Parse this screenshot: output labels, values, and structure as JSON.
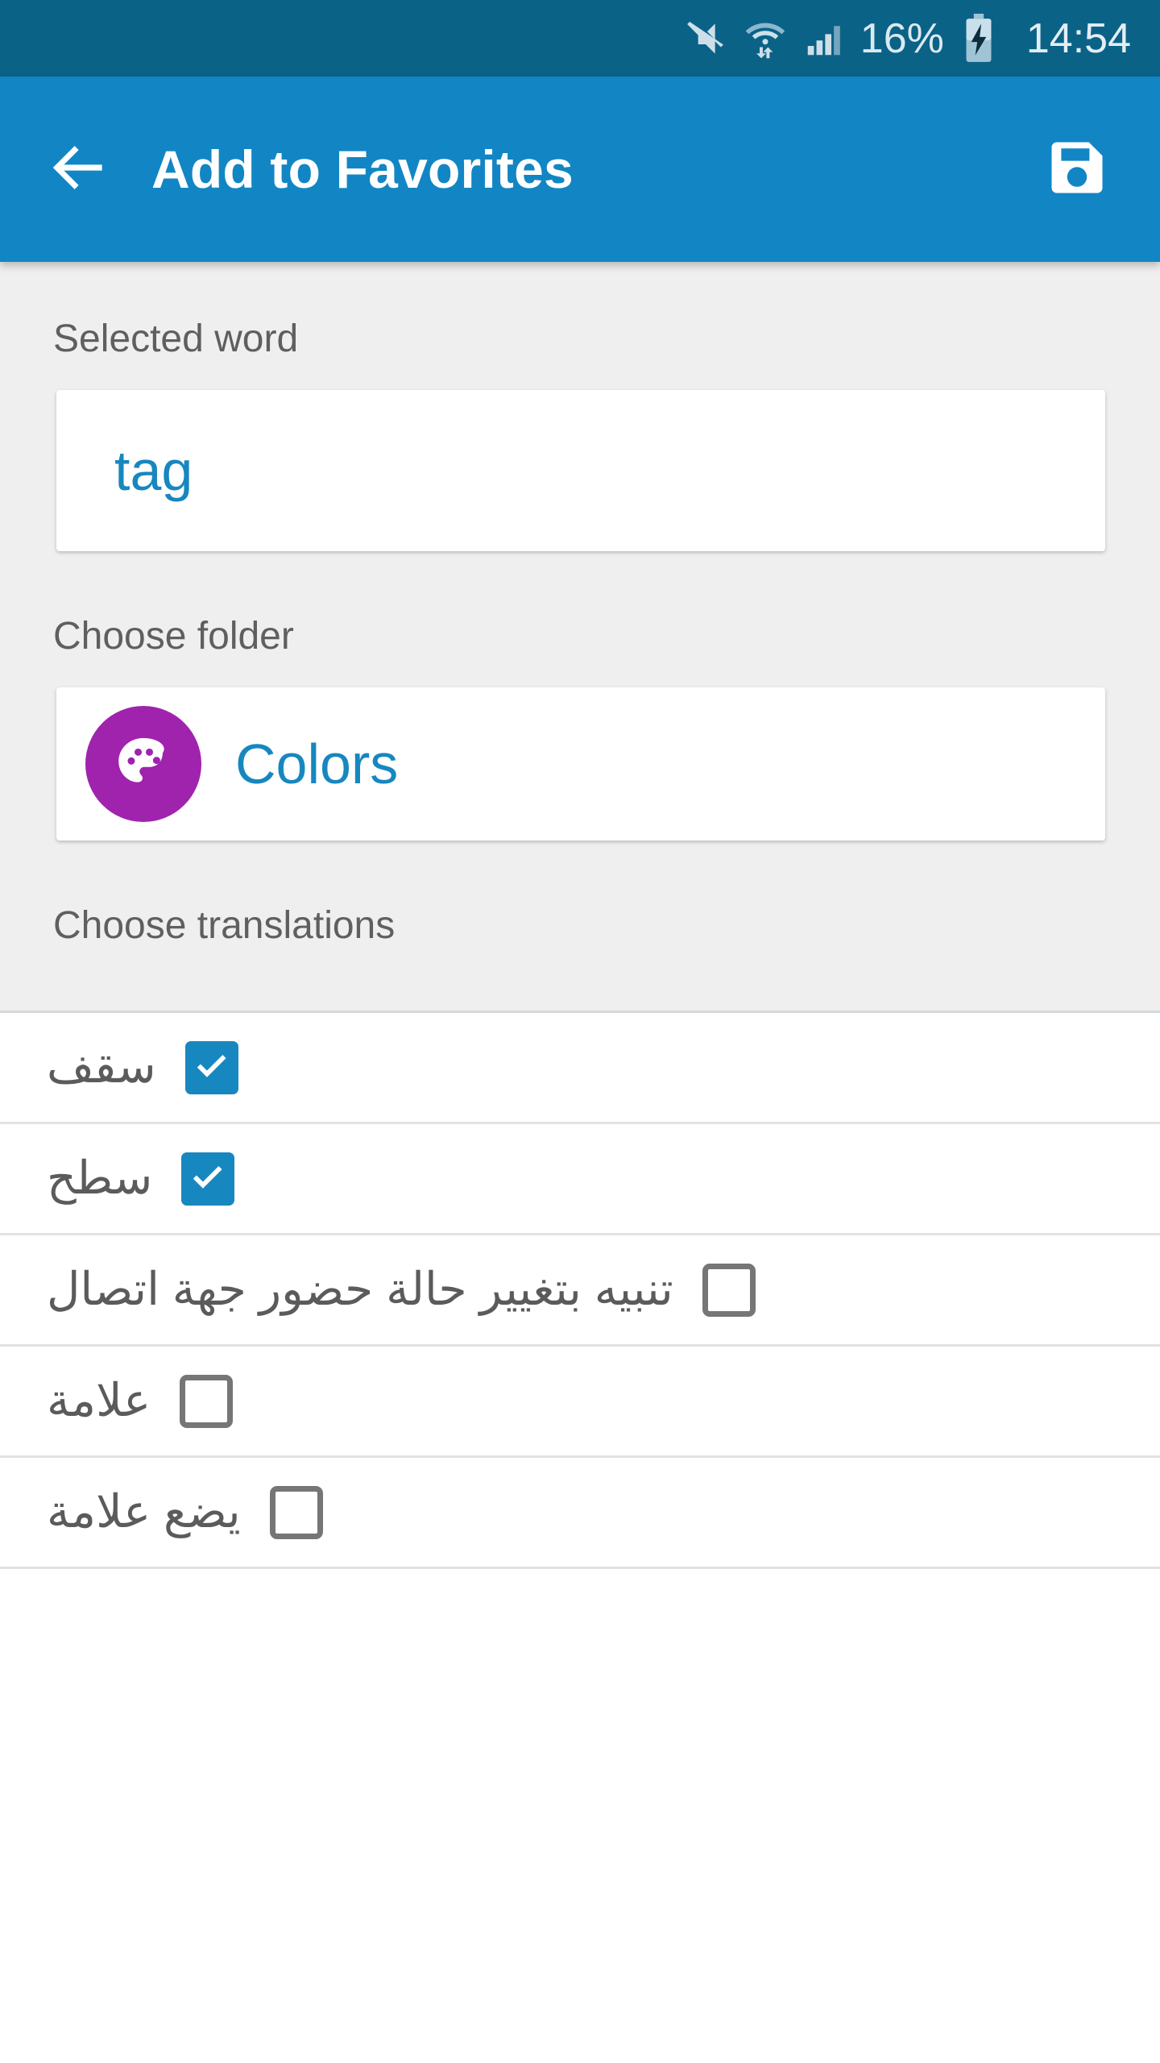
{
  "status_bar": {
    "background_color": "#0b6287",
    "battery_percent": "16%",
    "clock": "14:54",
    "icons": [
      "mute-icon",
      "wifi-icon",
      "signal-icon",
      "battery-charging-icon"
    ]
  },
  "app_bar": {
    "background_color": "#1286c4",
    "title": "Add to Favorites",
    "back_icon": "arrow-back-icon",
    "save_icon": "save-floppy-icon"
  },
  "form": {
    "selected_word_label": "Selected word",
    "selected_word_value": "tag",
    "choose_folder_label": "Choose folder",
    "folder_name": "Colors",
    "folder_icon": "palette-icon",
    "folder_color": "#a023ae",
    "choose_translations_label": "Choose translations",
    "accent_color": "#1787bf"
  },
  "translations": [
    {
      "text": "سقف",
      "checked": true
    },
    {
      "text": "سطح",
      "checked": true
    },
    {
      "text": "تنبيه بتغيير حالة حضور جهة اتصال",
      "checked": false
    },
    {
      "text": "علامة",
      "checked": false
    },
    {
      "text": "يضع علامة",
      "checked": false
    }
  ]
}
